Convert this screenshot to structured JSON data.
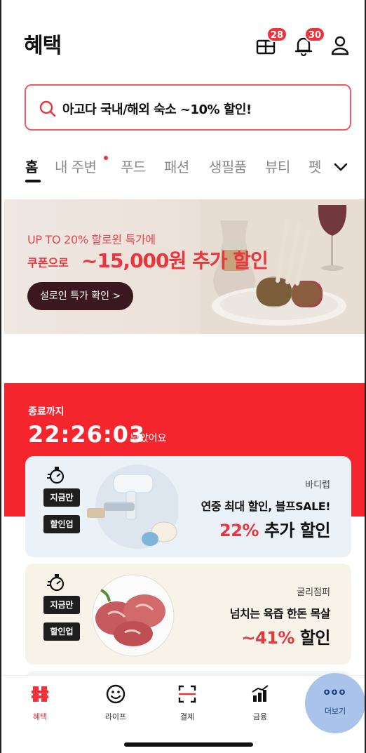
{
  "header": {
    "title": "혜택",
    "gift_badge": "28",
    "bell_badge": "30"
  },
  "search": {
    "text": "아고다 국내/해외 숙소 ~10% 할인!"
  },
  "tabs": [
    {
      "label": "홈",
      "active": true
    },
    {
      "label": "내 주변",
      "has_dot": true
    },
    {
      "label": "푸드"
    },
    {
      "label": "패션"
    },
    {
      "label": "생필품"
    },
    {
      "label": "뷰티"
    },
    {
      "label": "펫"
    }
  ],
  "banner": {
    "line1": "UP TO 20% 할로윈 특가에",
    "line2_prefix": "쿠폰으로",
    "line2_main": "~15,000원 추가 할인",
    "cta": "설로인 특가 확인 >"
  },
  "countdown": {
    "label": "종료까지",
    "time": "22:26:03",
    "suffix": "남았어요"
  },
  "deals": [
    {
      "tag1": "지금만",
      "tag2": "할인업",
      "brand": "바디럽",
      "desc": "연중 최대 할인, 블프SALE!",
      "discount_pct": "22%",
      "discount_text": "추가 할인"
    },
    {
      "tag1": "지금만",
      "tag2": "할인업",
      "brand": "굴리점퍼",
      "desc": "넘치는 육즙 한돈 목살",
      "discount_pct": "~41%",
      "discount_text": "할인"
    }
  ],
  "nav": [
    {
      "label": "혜택",
      "icon": "benefit-icon",
      "active": true
    },
    {
      "label": "라이프",
      "icon": "smile-icon"
    },
    {
      "label": "결제",
      "icon": "scan-icon"
    },
    {
      "label": "금융",
      "icon": "chart-icon"
    },
    {
      "label": "더보기",
      "icon": "more-icon",
      "dots": "ooo"
    }
  ],
  "colors": {
    "accent": "#f2313a",
    "countdown_bg": "#f5252e",
    "search_border": "#f05a61",
    "more_circle": "#a9c3ea"
  }
}
